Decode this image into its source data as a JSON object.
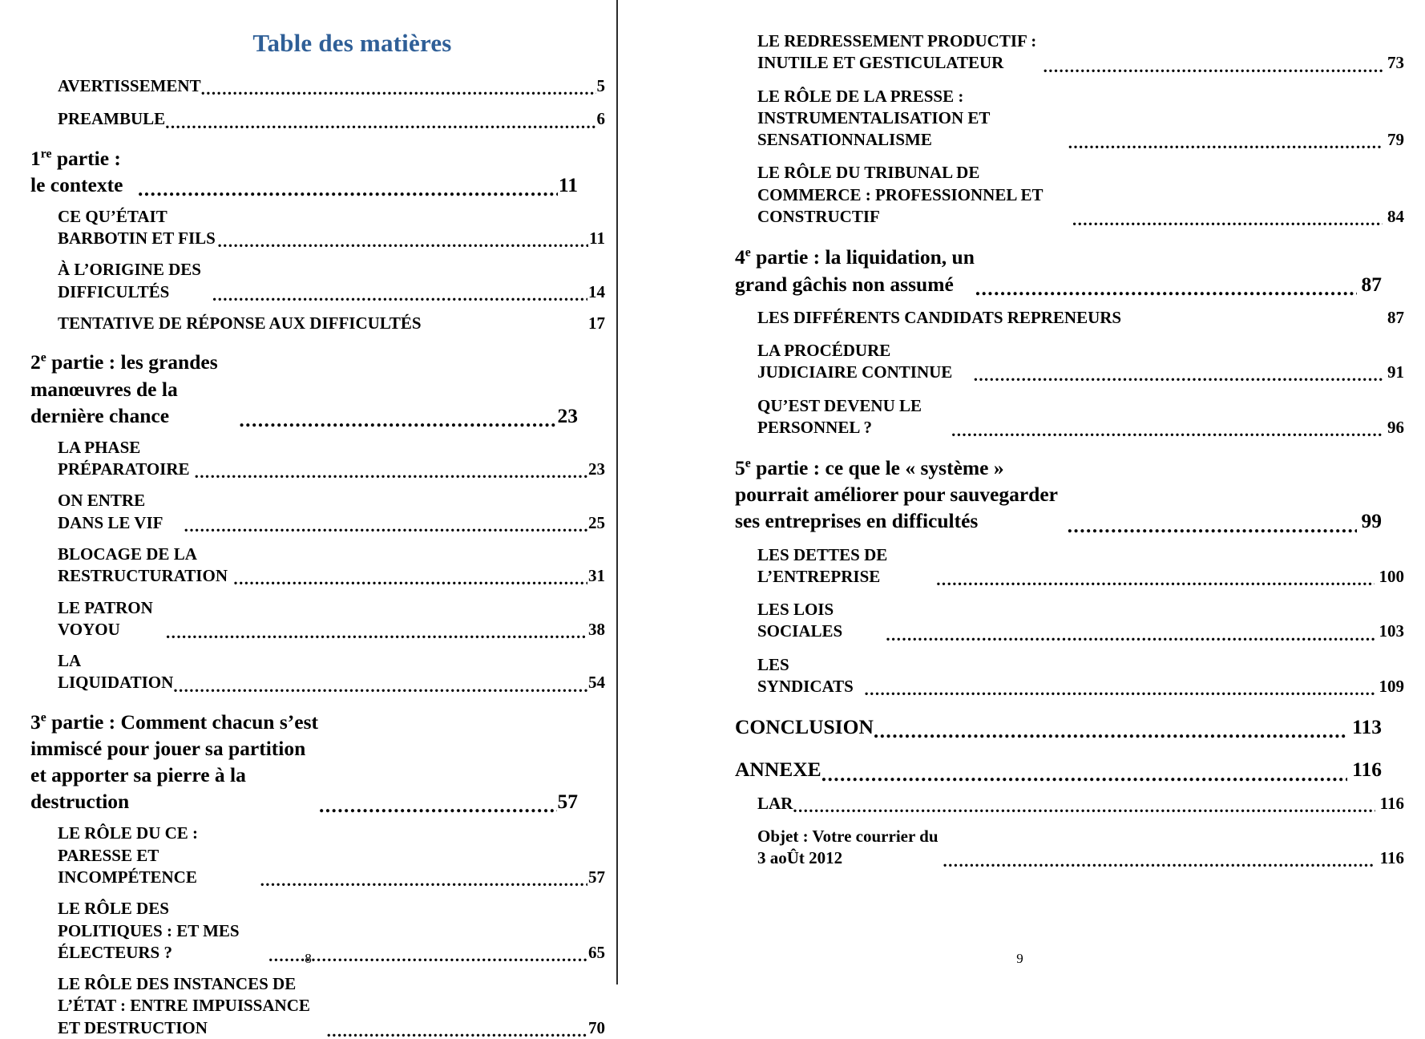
{
  "document": {
    "title": "Table des matières",
    "title_color": "#2f5f97",
    "left_folio": "8",
    "right_folio": "9"
  },
  "left_page": {
    "front_matter": [
      {
        "label": "AVERTISSEMENT",
        "page": "5"
      },
      {
        "label": "PREAMBULE",
        "page": "6"
      }
    ],
    "parts": [
      {
        "number": "1",
        "ordinal": "re",
        "heading": " partie : le contexte ",
        "page": "11",
        "sections": [
          {
            "label": "CE QU’ÉTAIT BARBOTIN ET FILS",
            "page": "11"
          },
          {
            "label": "À L’ORIGINE DES DIFFICULTÉS ",
            "page": "14"
          },
          {
            "label": "TENTATIVE DE RÉPONSE AUX DIFFICULTÉS",
            "page": "17"
          }
        ]
      },
      {
        "number": "2",
        "ordinal": "e",
        "heading": " partie : les grandes manœuvres de la dernière chance ",
        "page": "23",
        "sections": [
          {
            "label": "LA PHASE PRÉPARATOIRE",
            "page": "23"
          },
          {
            "label": "ON ENTRE DANS LE VIF",
            "page": "25"
          },
          {
            "label": "BLOCAGE DE LA RESTRUCTURATION ",
            "page": "31"
          },
          {
            "label": "LE PATRON VOYOU ",
            "page": "38"
          },
          {
            "label": "LA LIQUIDATION ",
            "page": "54"
          }
        ]
      },
      {
        "number": "3",
        "ordinal": "e",
        "heading": " partie : Comment chacun s’est immiscé pour jouer sa partition et apporter sa pierre à la destruction",
        "page": "57",
        "sections": [
          {
            "label": "LE RÔLE DU CE : PARESSE ET INCOMPÉTENCE ",
            "page": "57"
          },
          {
            "label": "LE RÔLE DES POLITIQUES : ET MES ÉLECTEURS ? ",
            "page": "65"
          },
          {
            "label": "LE RÔLE DES INSTANCES DE L’ÉTAT : ENTRE IMPUISSANCE ET DESTRUCTION ",
            "page": "70"
          }
        ]
      }
    ]
  },
  "right_page": {
    "continued_sections": [
      {
        "label": "LE REDRESSEMENT PRODUCTIF : INUTILE ET GESTICULATEUR ",
        "page": "73"
      },
      {
        "label": "LE RÔLE DE LA PRESSE : INSTRUMENTALISATION ET SENSATIONNALISME ",
        "page": "79"
      },
      {
        "label": "LE RÔLE DU TRIBUNAL DE COMMERCE : PROFESSIONNEL ET CONSTRUCTIF ",
        "page": "84"
      }
    ],
    "parts": [
      {
        "number": "4",
        "ordinal": "e",
        "heading": " partie : la liquidation, un grand gâchis non assumé ",
        "page": "87",
        "sections": [
          {
            "label": "LES DIFFÉRENTS CANDIDATS REPRENEURS",
            "page": "87"
          },
          {
            "label": "LA PROCÉDURE JUDICIAIRE CONTINUE ",
            "page": "91"
          },
          {
            "label": "QU’EST DEVENU LE PERSONNEL ?",
            "page": "96"
          }
        ]
      },
      {
        "number": "5",
        "ordinal": "e",
        "heading": " partie : ce que le « système » pourrait améliorer pour sauvegarder ses entreprises en difficultés",
        "page": "99",
        "sections": [
          {
            "label": "LES DETTES DE L’ENTREPRISE",
            "page": "100"
          },
          {
            "label": "LES LOIS SOCIALES",
            "page": "103"
          },
          {
            "label": "LES SYNDICATS ",
            "page": "109"
          }
        ]
      }
    ],
    "back_matter": [
      {
        "label": "CONCLUSION",
        "page": "113"
      },
      {
        "label": "ANNEXE",
        "page": "116"
      }
    ],
    "annexe_sections": [
      {
        "label": "LAR ",
        "page": "116"
      },
      {
        "label": "Objet : Votre courrier du 3 aoÛt 2012 ",
        "page": "116"
      }
    ]
  }
}
